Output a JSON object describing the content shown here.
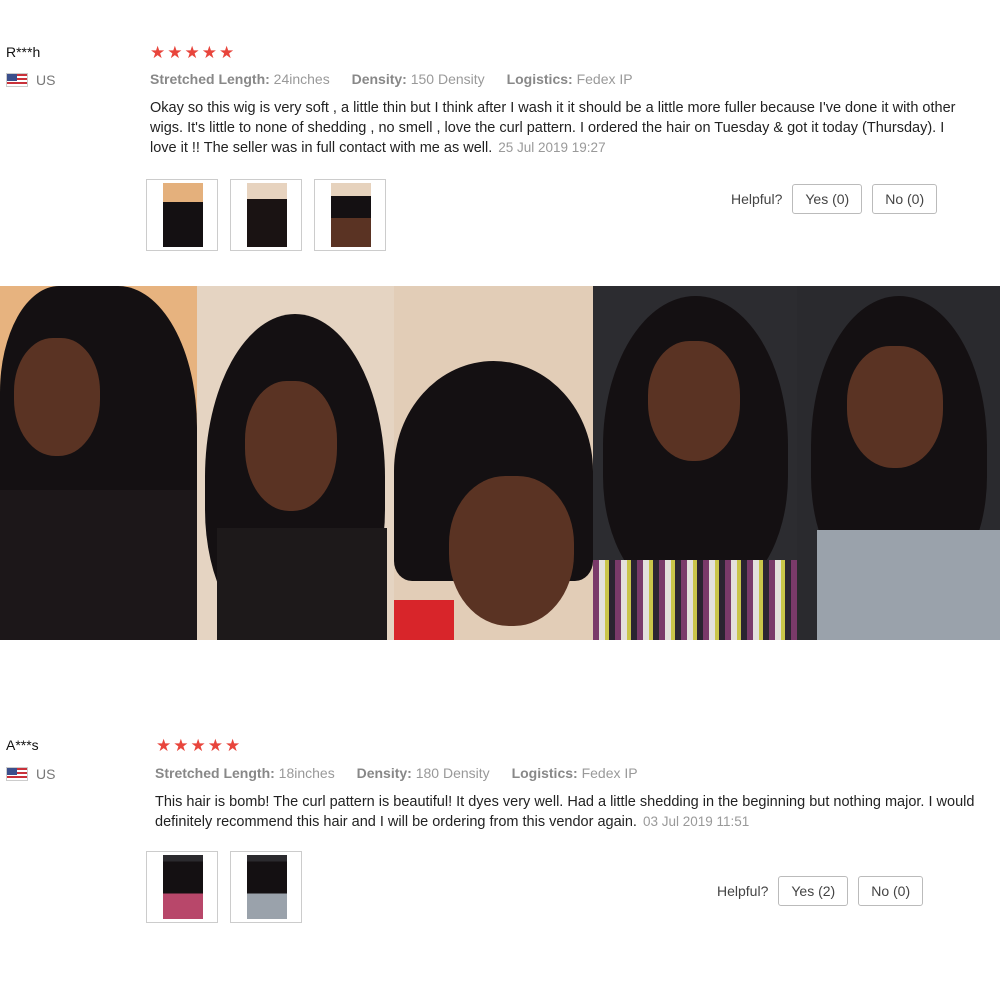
{
  "reviews": [
    {
      "name": "R***h",
      "country": "US",
      "stars": "★★★★★",
      "meta": {
        "length_label": "Stretched Length:",
        "length_value": "24inches",
        "density_label": "Density:",
        "density_value": "150 Density",
        "logistics_label": "Logistics:",
        "logistics_value": "Fedex IP"
      },
      "text": "Okay so this wig is very soft , a little thin but I think after I wash it it should be a little more fuller because I've done it with other wigs. It's little to none of shedding , no smell , love the curl pattern. I ordered the hair on Tuesday & got it today (Thursday). I love it !! The seller was in full contact with me as well.",
      "date": "25 Jul 2019 19:27",
      "helpful_label": "Helpful?",
      "yes_label": "Yes (0)",
      "no_label": "No (0)"
    },
    {
      "name": "A***s",
      "country": "US",
      "stars": "★★★★★",
      "meta": {
        "length_label": "Stretched Length:",
        "length_value": "18inches",
        "density_label": "Density:",
        "density_value": "180 Density",
        "logistics_label": "Logistics:",
        "logistics_value": "Fedex IP"
      },
      "text": "This hair is bomb! The curl pattern is beautiful! It dyes very well. Had a little shedding in the beginning but nothing major. I would definitely recommend this hair and I will be ordering from this vendor again.",
      "date": "03 Jul 2019 11:51",
      "helpful_label": "Helpful?",
      "yes_label": "Yes (2)",
      "no_label": "No (0)"
    }
  ],
  "colors": {
    "star": "#e8453c",
    "meta": "#999999",
    "border": "#cccccc"
  },
  "icons": {
    "flag": "us-flag-icon",
    "star": "star-icon"
  }
}
